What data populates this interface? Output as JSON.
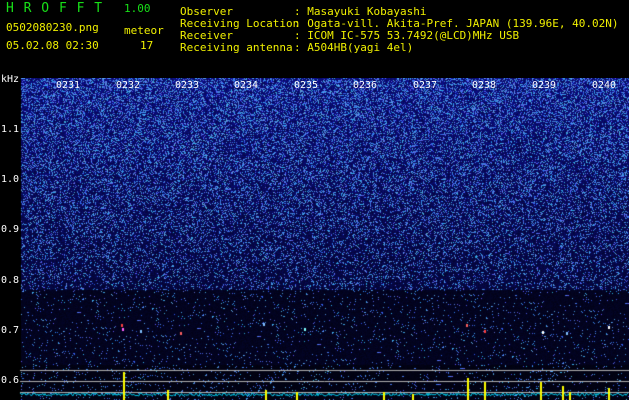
{
  "app": {
    "name": "H R O F F T",
    "version": "1.00"
  },
  "file": {
    "name": "0502080230.png",
    "datetime": "05.02.08 02:30"
  },
  "meteor": {
    "label": "meteor",
    "count": "17"
  },
  "info": [
    {
      "key": "Observer",
      "value": ": Masayuki Kobayashi"
    },
    {
      "key": "Receiving Location",
      "value": ": Ogata-vill. Akita-Pref. JAPAN (139.96E, 40.02N)"
    },
    {
      "key": "Receiver",
      "value": ": ICOM IC-575 53.7492(@LCD)MHz USB"
    },
    {
      "key": "Receiving antenna",
      "value": ": A504HB(yagi 4el)"
    }
  ],
  "axis": {
    "unit": "kHz",
    "y_ticks": [
      "1.1",
      "1.0",
      "0.9",
      "0.8",
      "0.7",
      "0.6"
    ],
    "x_ticks": [
      "0231",
      "0232",
      "0233",
      "0234",
      "0235",
      "0236",
      "0237",
      "0238",
      "0239",
      "0240"
    ]
  },
  "colors": {
    "background": "#000000",
    "spectrum": "#1a1aa0",
    "noise": "#3a5cff",
    "signal": "#ffff00",
    "trace": "#00c0e0",
    "title": "#18e018"
  }
}
